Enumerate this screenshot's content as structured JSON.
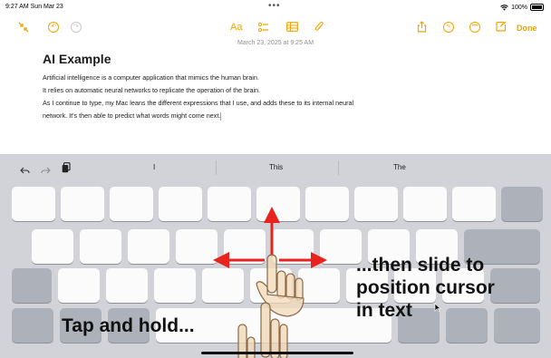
{
  "status": {
    "time_date": "9:27 AM  Sun Mar 23",
    "dots": "•••",
    "battery": "100%"
  },
  "toolbar": {
    "format": "Aa",
    "done": "Done"
  },
  "note": {
    "date": "March 23, 2025 at 9:25 AM",
    "title": "AI Example",
    "lines": [
      "Artificial intelligence is a computer application that mimics the human brain.",
      "It relies on automatic neural networks to replicate the operation of the brain.",
      "As I continue to type, my Mac leans the different expressions that I use, and adds these to its internal neural",
      "network. It's then able to predict what words might come next."
    ]
  },
  "suggestions": [
    "I",
    "This",
    "The"
  ],
  "overlay": {
    "caption_left": "Tap and hold...",
    "caption_right_lines": [
      "...then slide to",
      "position cursor",
      "in text"
    ],
    "arrow_color": "#e8231e"
  },
  "colors": {
    "accent": "#f0a400",
    "keyboard_bg": "#d1d3d9"
  }
}
